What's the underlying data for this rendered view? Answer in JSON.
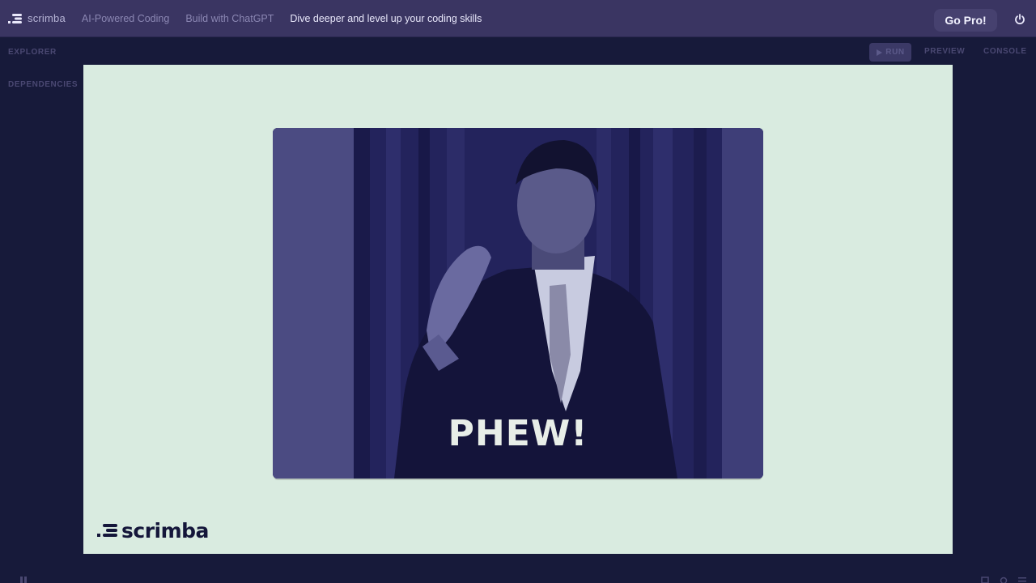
{
  "header": {
    "brand_name": "scrimba",
    "breadcrumbs": [
      {
        "label": "AI-Powered Coding"
      },
      {
        "label": "Build with ChatGPT"
      },
      {
        "label": "Dive deeper and level up your coding skills"
      }
    ],
    "go_pro_label": "Go Pro!",
    "power_icon": "power-icon"
  },
  "sidebar": {
    "explorer_label": "EXPLORER",
    "dependencies_label": "DEPENDENCIES"
  },
  "toolbar": {
    "run_label": "RUN",
    "preview_label": "PREVIEW",
    "console_label": "CONSOLE"
  },
  "slide": {
    "gif_caption": "PHEW!",
    "watermark_text": "scrimba"
  },
  "colors": {
    "topbar": "#3a3562",
    "background": "#171a3a",
    "slide_background": "#d9ebe0",
    "gif_tint": "#1c1c52"
  }
}
